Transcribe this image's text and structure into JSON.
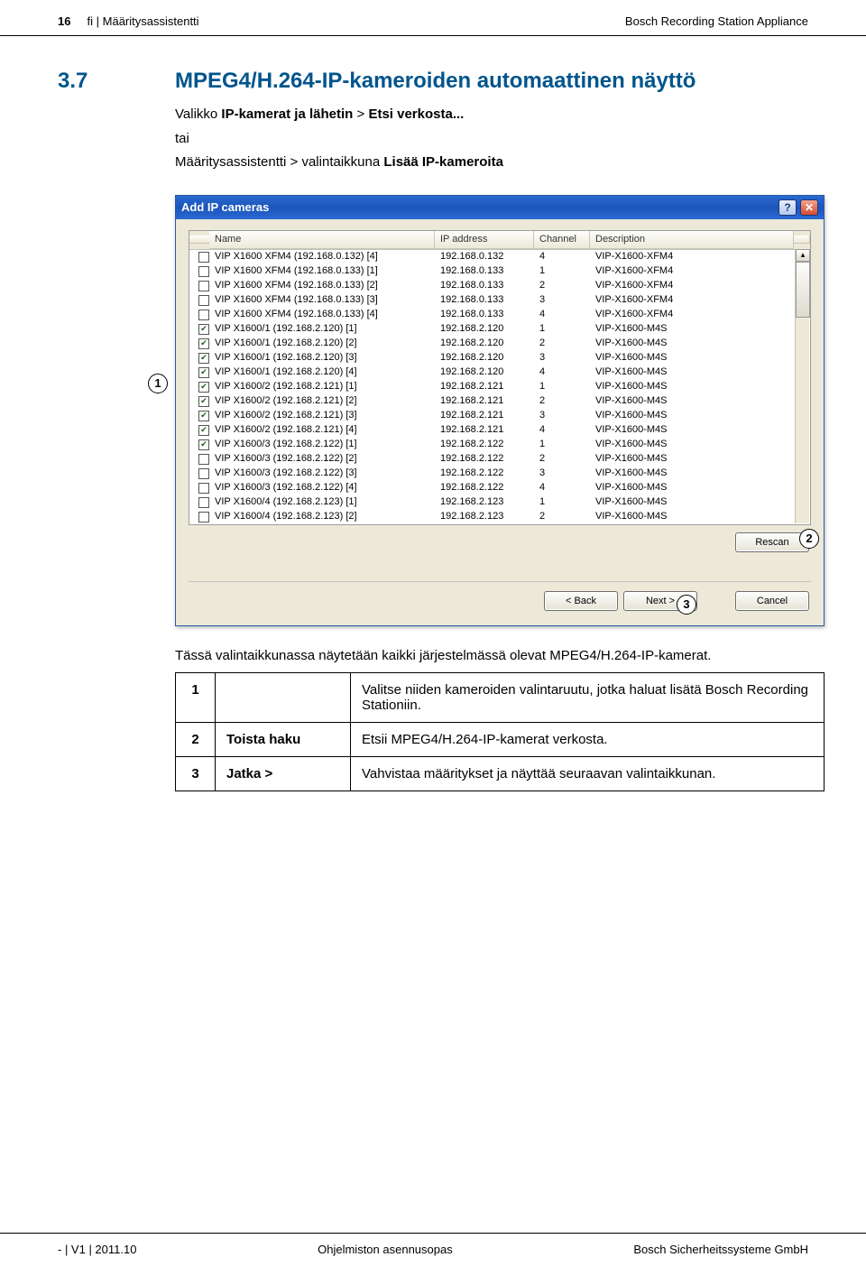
{
  "header": {
    "page_left": "16",
    "breadcrumb": "fi | Määritysassistentti",
    "right": "Bosch Recording Station Appliance"
  },
  "section": {
    "num": "3.7",
    "title": "MPEG4/H.264-IP-kameroiden automaattinen näyttö",
    "p1_a": "Valikko ",
    "p1_b": "IP-kamerat ja lähetin",
    "p1_c": " > ",
    "p1_d": "Etsi verkosta...",
    "p2": "tai",
    "p3_a": "Määritysassistentti > valintaikkuna ",
    "p3_b": "Lisää IP-kameroita"
  },
  "dialog": {
    "title": "Add IP cameras",
    "help": "?",
    "col_name": "Name",
    "col_ip": "IP address",
    "col_ch": "Channel",
    "col_desc": "Description",
    "rows": [
      {
        "checked": false,
        "name": "VIP X1600 XFM4 (192.168.0.132) [4]",
        "ip": "192.168.0.132",
        "ch": "4",
        "desc": "VIP-X1600-XFM4"
      },
      {
        "checked": false,
        "name": "VIP X1600 XFM4 (192.168.0.133) [1]",
        "ip": "192.168.0.133",
        "ch": "1",
        "desc": "VIP-X1600-XFM4"
      },
      {
        "checked": false,
        "name": "VIP X1600 XFM4 (192.168.0.133) [2]",
        "ip": "192.168.0.133",
        "ch": "2",
        "desc": "VIP-X1600-XFM4"
      },
      {
        "checked": false,
        "name": "VIP X1600 XFM4 (192.168.0.133) [3]",
        "ip": "192.168.0.133",
        "ch": "3",
        "desc": "VIP-X1600-XFM4"
      },
      {
        "checked": false,
        "name": "VIP X1600 XFM4 (192.168.0.133) [4]",
        "ip": "192.168.0.133",
        "ch": "4",
        "desc": "VIP-X1600-XFM4"
      },
      {
        "checked": true,
        "name": "VIP X1600/1 (192.168.2.120) [1]",
        "ip": "192.168.2.120",
        "ch": "1",
        "desc": "VIP-X1600-M4S"
      },
      {
        "checked": true,
        "name": "VIP X1600/1 (192.168.2.120) [2]",
        "ip": "192.168.2.120",
        "ch": "2",
        "desc": "VIP-X1600-M4S"
      },
      {
        "checked": true,
        "name": "VIP X1600/1 (192.168.2.120) [3]",
        "ip": "192.168.2.120",
        "ch": "3",
        "desc": "VIP-X1600-M4S"
      },
      {
        "checked": true,
        "name": "VIP X1600/1 (192.168.2.120) [4]",
        "ip": "192.168.2.120",
        "ch": "4",
        "desc": "VIP-X1600-M4S"
      },
      {
        "checked": true,
        "name": "VIP X1600/2 (192.168.2.121) [1]",
        "ip": "192.168.2.121",
        "ch": "1",
        "desc": "VIP-X1600-M4S"
      },
      {
        "checked": true,
        "name": "VIP X1600/2 (192.168.2.121) [2]",
        "ip": "192.168.2.121",
        "ch": "2",
        "desc": "VIP-X1600-M4S"
      },
      {
        "checked": true,
        "name": "VIP X1600/2 (192.168.2.121) [3]",
        "ip": "192.168.2.121",
        "ch": "3",
        "desc": "VIP-X1600-M4S"
      },
      {
        "checked": true,
        "name": "VIP X1600/2 (192.168.2.121) [4]",
        "ip": "192.168.2.121",
        "ch": "4",
        "desc": "VIP-X1600-M4S"
      },
      {
        "checked": true,
        "name": "VIP X1600/3 (192.168.2.122) [1]",
        "ip": "192.168.2.122",
        "ch": "1",
        "desc": "VIP-X1600-M4S"
      },
      {
        "checked": false,
        "name": "VIP X1600/3 (192.168.2.122) [2]",
        "ip": "192.168.2.122",
        "ch": "2",
        "desc": "VIP-X1600-M4S"
      },
      {
        "checked": false,
        "name": "VIP X1600/3 (192.168.2.122) [3]",
        "ip": "192.168.2.122",
        "ch": "3",
        "desc": "VIP-X1600-M4S"
      },
      {
        "checked": false,
        "name": "VIP X1600/3 (192.168.2.122) [4]",
        "ip": "192.168.2.122",
        "ch": "4",
        "desc": "VIP-X1600-M4S"
      },
      {
        "checked": false,
        "name": "VIP X1600/4 (192.168.2.123) [1]",
        "ip": "192.168.2.123",
        "ch": "1",
        "desc": "VIP-X1600-M4S"
      },
      {
        "checked": false,
        "name": "VIP X1600/4 (192.168.2.123) [2]",
        "ip": "192.168.2.123",
        "ch": "2",
        "desc": "VIP-X1600-M4S"
      }
    ],
    "rescan": "Rescan",
    "back": "< Back",
    "next": "Next >",
    "cancel": "Cancel"
  },
  "callouts": {
    "c1": "1",
    "c2": "2",
    "c3": "3"
  },
  "after": "Tässä valintaikkunassa näytetään kaikki järjestelmässä olevat MPEG4/H.264-IP-kamerat.",
  "reftable": {
    "r1n": "1",
    "r1l": "",
    "r1d": "Valitse niiden kameroiden valintaruutu, jotka haluat lisätä Bosch Recording Stationiin.",
    "r2n": "2",
    "r2l": "Toista haku",
    "r2d": "Etsii MPEG4/H.264-IP-kamerat verkosta.",
    "r3n": "3",
    "r3l": "Jatka >",
    "r3d": "Vahvistaa määritykset ja näyttää seuraavan valintaikkunan."
  },
  "footer": {
    "left": "- | V1 | 2011.10",
    "center": "Ohjelmiston asennusopas",
    "right": "Bosch Sicherheitssysteme GmbH"
  }
}
